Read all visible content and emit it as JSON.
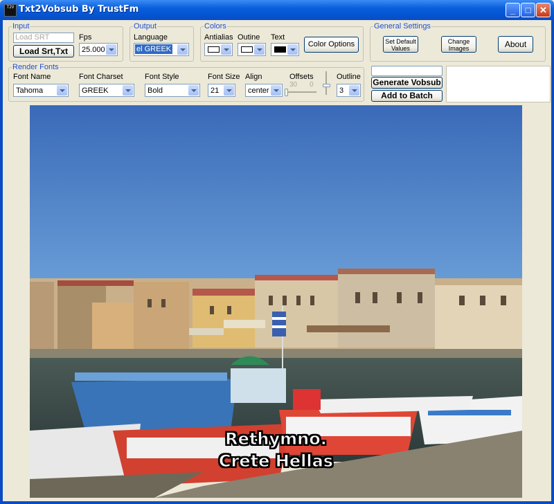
{
  "window": {
    "title": "Txt2Vobsub By TrustFm",
    "icon_text": "T2V",
    "controls": [
      "minimize-icon",
      "maximize-icon",
      "close-icon"
    ]
  },
  "input": {
    "group_title": "Input",
    "srt_placeholder": "Load SRT",
    "load_button": "Load Srt,Txt",
    "fps_label": "Fps",
    "fps_value": "25.000"
  },
  "output": {
    "group_title": "Output",
    "language_label": "Language",
    "language_value": "el GREEK"
  },
  "colors": {
    "group_title": "Colors",
    "antialias_label": "Antialias",
    "outline_label": "Outine",
    "text_label": "Text",
    "color_options_button": "Color Options",
    "antialias_color": "#ffffff",
    "outline_color": "#ffffff",
    "text_color": "#000000"
  },
  "general": {
    "group_title": "General Settings",
    "default_button": "Set Default Values",
    "change_images_button": "Change Images",
    "about_button": "About"
  },
  "render": {
    "group_title": "Render Fonts",
    "font_name_label": "Font Name",
    "font_name_value": "Tahoma",
    "charset_label": "Font Charset",
    "charset_value": "GREEK",
    "style_label": "Font Style",
    "style_value": "Bold",
    "size_label": "Font Size",
    "size_value": "21",
    "align_label": "Align",
    "align_value": "center",
    "offsets_label": "Offsets",
    "offset_x": "30",
    "offset_y": "0",
    "outline_label": "Outline",
    "outline_value": "3"
  },
  "actions": {
    "generate_button": "Generate Vobsub",
    "batch_button": "Add to Batch"
  },
  "preview": {
    "subtitle_line1": "Rethymno.",
    "subtitle_line2": "Crete Hellas"
  }
}
